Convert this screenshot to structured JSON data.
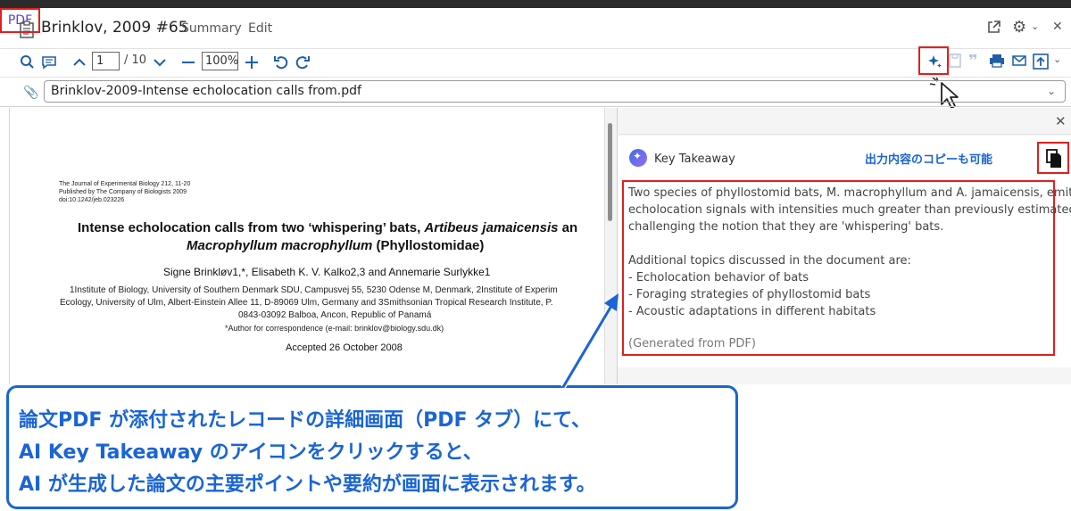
{
  "header": {
    "title": "Brinklov, 2009 #65",
    "tabs": {
      "summary": "Summary",
      "edit": "Edit",
      "pdf": "PDF"
    }
  },
  "toolbar": {
    "page_value": "1",
    "page_total": "/ 10",
    "zoom_value": "100%"
  },
  "file": {
    "name": "Brinklov-2009-Intense echolocation calls from.pdf"
  },
  "pdf": {
    "journal_line1": "The Journal of Experimental Biology 212, 11-20",
    "journal_line2": "Published by The Company of Biologists 2009",
    "journal_line3": "doi:10.1242/jeb.023226",
    "title_part1": "Intense echolocation calls from two ‘whispering’ bats, ",
    "title_italic1": "Artibeus jamaicensis",
    "title_part2": " an",
    "title2_italic": "Macrophyllum macrophyllum",
    "title2_rest": " (Phyllostomidae)",
    "authors": "Signe Brinkløv1,*, Elisabeth K. V. Kalko2,3 and Annemarie Surlykke1",
    "aff1": "1Institute of Biology, University of Southern Denmark SDU, Campusvej 55, 5230 Odense M, Denmark, 2Institute of Experim",
    "aff2": "Ecology, University of Ulm, Albert-Einstein Allee 11, D-89069 Ulm, Germany and 3Smithsonian Tropical Research Institute, P.",
    "aff3": "0843-03092 Balboa, Ancon, Republic of Panamá",
    "corr": "*Author for correspondence (e-mail: brinklov@biology.sdu.dk)",
    "accepted": "Accepted 26 October 2008"
  },
  "panel": {
    "title": "Key Takeaway",
    "copy_note": "出力内容のコピーも可能",
    "lines": [
      "Two species of phyllostomid bats, M. macrophyllum and A. jamaicensis, emit",
      "echolocation signals with intensities much greater than previously estimated,",
      "challenging the notion that they are 'whispering' bats.",
      "Additional topics discussed in the document are:",
      "- Echolocation behavior of bats",
      "- Foraging strategies of phyllostomid bats",
      "- Acoustic adaptations in different habitats",
      "(Generated from PDF)"
    ]
  },
  "callout": {
    "line1": "論文PDF が添付されたレコードの詳細画面（PDF タブ）にて、",
    "line2": "AI Key Takeaway のアイコンをクリックすると、",
    "line3": "AI が生成した論文の主要ポイントや要約が画面に表示されます。"
  },
  "colors": {
    "accent_red": "#e0201e",
    "link_blue": "#1a64d6",
    "pdf_tab_purple": "#5b3fd6"
  },
  "icons": [
    "document-icon",
    "external-link-icon",
    "gear-icon",
    "search-icon",
    "comment-icon",
    "chevron-up-icon",
    "chevron-down-icon",
    "minus-icon",
    "plus-icon",
    "rotate-left-icon",
    "rotate-right-icon",
    "ai-sparkle-icon",
    "save-icon",
    "quote-icon",
    "print-icon",
    "mail-icon",
    "export-icon",
    "paperclip-icon",
    "close-icon",
    "copy-icon",
    "mouse-cursor-icon"
  ]
}
